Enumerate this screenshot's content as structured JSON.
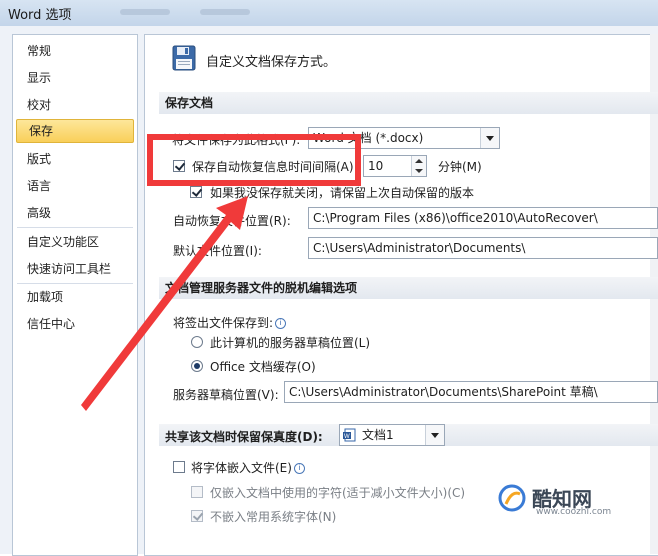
{
  "window": {
    "title": "Word 选项"
  },
  "sidebar": {
    "items": [
      {
        "label": "常规"
      },
      {
        "label": "显示"
      },
      {
        "label": "校对"
      },
      {
        "label": "保存"
      },
      {
        "label": "版式"
      },
      {
        "label": "语言"
      },
      {
        "label": "高级"
      },
      {
        "label": "自定义功能区"
      },
      {
        "label": "快速访问工具栏"
      },
      {
        "label": "加载项"
      },
      {
        "label": "信任中心"
      }
    ],
    "selected": "保存"
  },
  "main": {
    "header": "自定义文档保存方式。",
    "save_docs": {
      "title": "保存文档",
      "format_label": "将文件保存为此格式(F):",
      "format_value": "Word 文档 (*.docx)",
      "autorecover_checkbox_label": "保存自动恢复信息时间间隔(A)",
      "autorecover_checked": true,
      "interval_value": "10",
      "minutes_label": "分钟(M)",
      "keep_last_label": "如果我没保存就关闭，请保留上次自动保留的版本",
      "keep_last_checked": true,
      "autorecover_location_label": "自动恢复文件位置(R):",
      "autorecover_location_value": "C:\\Program Files (x86)\\office2010\\AutoRecover\\",
      "default_location_label": "默认文件位置(I):",
      "default_location_value": "C:\\Users\\Administrator\\Documents\\"
    },
    "offline": {
      "title": "文档管理服务器文件的脱机编辑选项",
      "checkout_label": "将签出文件保存到:",
      "option_server": "此计算机的服务器草稿位置(L)",
      "option_cache": "Office 文档缓存(O)",
      "selected": "Office 文档缓存(O)",
      "drafts_location_label": "服务器草稿位置(V):",
      "drafts_location_value": "C:\\Users\\Administrator\\Documents\\SharePoint 草稿\\"
    },
    "fidelity": {
      "title": "共享该文档时保留保真度(D):",
      "doc_value": "文档1",
      "embed_fonts_label": "将字体嵌入文件(E)",
      "embed_fonts_checked": false,
      "embed_used_chars_label": "仅嵌入文档中使用的字符(适于减小文件大小)(C)",
      "embed_used_chars_checked": false,
      "no_common_fonts_label": "不嵌入常用系统字体(N)",
      "no_common_fonts_checked": true
    }
  },
  "watermark": {
    "brand": "酷知网",
    "url": "www.coozhi.com"
  },
  "annotation_color": "#f03a3a"
}
